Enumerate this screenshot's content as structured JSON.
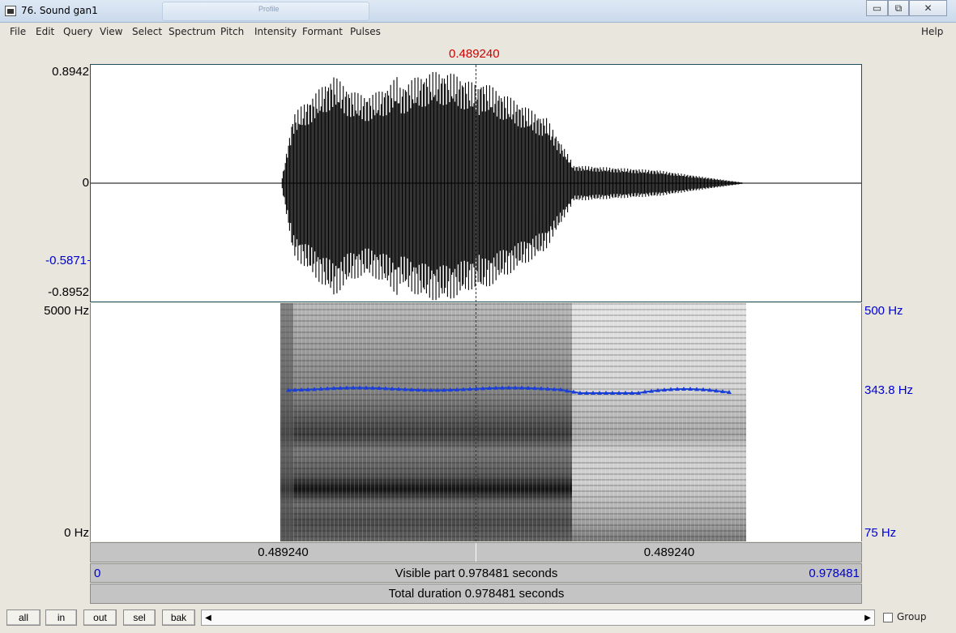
{
  "window": {
    "title": "76. Sound gan1",
    "ghost_tab_label": "Profile",
    "minimize": "▭",
    "maximize": "⧉",
    "close": "✕"
  },
  "menu": {
    "left": [
      "File",
      "Edit",
      "Query",
      "View",
      "Select",
      "Spectrum",
      "Pitch",
      "Intensity",
      "Formant",
      "Pulses"
    ],
    "help": "Help"
  },
  "cursor": {
    "time_label": "0.489240"
  },
  "waveform": {
    "max_label": "0.8942",
    "zero_label": "0",
    "cursor_value_label": "-0.5871",
    "min_label": "-0.8952"
  },
  "spectrogram": {
    "freq_top_label": "5000 Hz",
    "freq_bottom_label": "0 Hz",
    "pitch_top_label": "500 Hz",
    "pitch_cursor_label": "343.8 Hz",
    "pitch_bottom_label": "75 Hz",
    "colors": {
      "pitch_line": "#1a3fd6",
      "cursor": "#d00000"
    }
  },
  "time_bars": {
    "left_segment": "0.489240",
    "right_segment": "0.489240",
    "visible_start": "0",
    "visible_text": "Visible part 0.978481 seconds",
    "visible_end": "0.978481",
    "total_text": "Total duration 0.978481 seconds"
  },
  "bottom": {
    "buttons": [
      "all",
      "in",
      "out",
      "sel",
      "bak"
    ],
    "scroll_left": "◀",
    "scroll_right": "▶",
    "group_label": "Group"
  }
}
